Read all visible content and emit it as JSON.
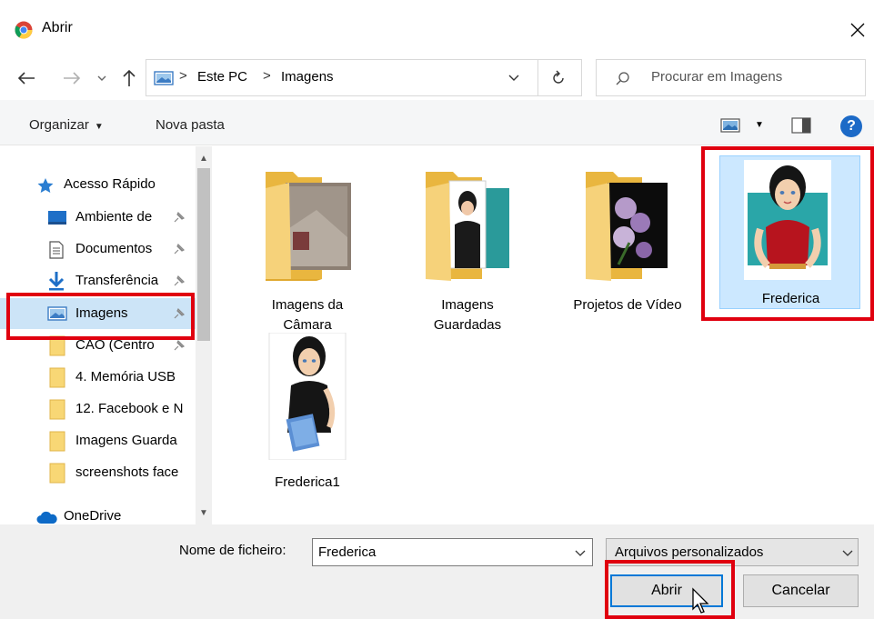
{
  "window": {
    "title": "Abrir"
  },
  "address": {
    "crumbs": [
      "Este PC",
      "Imagens"
    ],
    "separator": ">"
  },
  "search": {
    "placeholder": "Procurar em Imagens"
  },
  "toolbar": {
    "organize_label": "Organizar",
    "new_folder_label": "Nova pasta",
    "help_label": "?"
  },
  "sidebar": {
    "items": [
      {
        "label": "Acesso Rápido",
        "icon": "star-icon",
        "pinned": false
      },
      {
        "label": "Ambiente de ",
        "icon": "desktop-icon",
        "pinned": true
      },
      {
        "label": "Documentos",
        "icon": "documents-icon",
        "pinned": true
      },
      {
        "label": "Transferência",
        "icon": "download-icon",
        "pinned": true
      },
      {
        "label": "Imagens",
        "icon": "pictures-icon",
        "pinned": true,
        "selected": true
      },
      {
        "label": "CAO (Centro ",
        "icon": "folder-icon",
        "pinned": true
      },
      {
        "label": "4. Memória USB",
        "icon": "folder-icon",
        "pinned": false
      },
      {
        "label": "12. Facebook e N",
        "icon": "folder-icon",
        "pinned": false
      },
      {
        "label": "Imagens Guarda",
        "icon": "folder-icon",
        "pinned": false
      },
      {
        "label": "screenshots face",
        "icon": "folder-icon",
        "pinned": false
      },
      {
        "label": "OneDrive",
        "icon": "onedrive-icon",
        "pinned": false
      }
    ]
  },
  "files": [
    {
      "name_line1": "Imagens da",
      "name_line2": "Câmara",
      "type": "folder"
    },
    {
      "name_line1": "Imagens",
      "name_line2": "Guardadas",
      "type": "folder"
    },
    {
      "name_line1": "Projetos de Vídeo",
      "name_line2": "",
      "type": "folder"
    },
    {
      "name_line1": "Frederica",
      "name_line2": "",
      "type": "image",
      "selected": true
    },
    {
      "name_line1": "Frederica1",
      "name_line2": "",
      "type": "image"
    }
  ],
  "footer": {
    "filename_label": "Nome de ficheiro:",
    "filename_value": "Frederica",
    "filetype_value": "Arquivos personalizados",
    "open_label": "Abrir",
    "cancel_label": "Cancelar"
  },
  "colors": {
    "highlight": "#e0000f",
    "selection": "#cce8ff",
    "accent": "#0078d7"
  }
}
